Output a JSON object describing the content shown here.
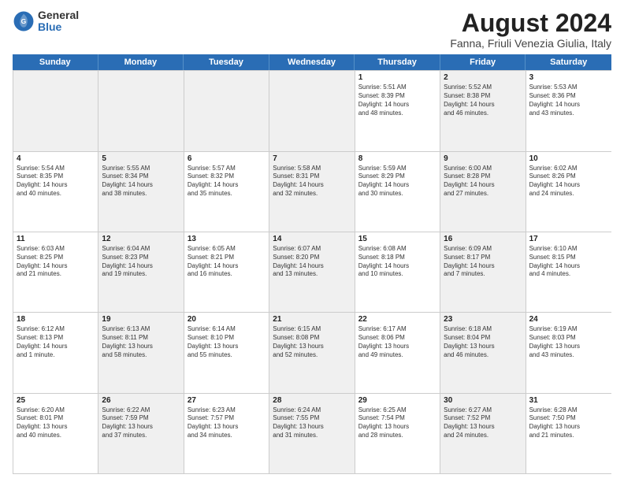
{
  "logo": {
    "general": "General",
    "blue": "Blue"
  },
  "title": "August 2024",
  "location": "Fanna, Friuli Venezia Giulia, Italy",
  "days": [
    "Sunday",
    "Monday",
    "Tuesday",
    "Wednesday",
    "Thursday",
    "Friday",
    "Saturday"
  ],
  "weeks": [
    [
      {
        "day": "",
        "text": "",
        "shaded": true
      },
      {
        "day": "",
        "text": "",
        "shaded": true
      },
      {
        "day": "",
        "text": "",
        "shaded": true
      },
      {
        "day": "",
        "text": "",
        "shaded": true
      },
      {
        "day": "1",
        "text": "Sunrise: 5:51 AM\nSunset: 8:39 PM\nDaylight: 14 hours\nand 48 minutes."
      },
      {
        "day": "2",
        "text": "Sunrise: 5:52 AM\nSunset: 8:38 PM\nDaylight: 14 hours\nand 46 minutes.",
        "shaded": true
      },
      {
        "day": "3",
        "text": "Sunrise: 5:53 AM\nSunset: 8:36 PM\nDaylight: 14 hours\nand 43 minutes."
      }
    ],
    [
      {
        "day": "4",
        "text": "Sunrise: 5:54 AM\nSunset: 8:35 PM\nDaylight: 14 hours\nand 40 minutes."
      },
      {
        "day": "5",
        "text": "Sunrise: 5:55 AM\nSunset: 8:34 PM\nDaylight: 14 hours\nand 38 minutes.",
        "shaded": true
      },
      {
        "day": "6",
        "text": "Sunrise: 5:57 AM\nSunset: 8:32 PM\nDaylight: 14 hours\nand 35 minutes."
      },
      {
        "day": "7",
        "text": "Sunrise: 5:58 AM\nSunset: 8:31 PM\nDaylight: 14 hours\nand 32 minutes.",
        "shaded": true
      },
      {
        "day": "8",
        "text": "Sunrise: 5:59 AM\nSunset: 8:29 PM\nDaylight: 14 hours\nand 30 minutes."
      },
      {
        "day": "9",
        "text": "Sunrise: 6:00 AM\nSunset: 8:28 PM\nDaylight: 14 hours\nand 27 minutes.",
        "shaded": true
      },
      {
        "day": "10",
        "text": "Sunrise: 6:02 AM\nSunset: 8:26 PM\nDaylight: 14 hours\nand 24 minutes."
      }
    ],
    [
      {
        "day": "11",
        "text": "Sunrise: 6:03 AM\nSunset: 8:25 PM\nDaylight: 14 hours\nand 21 minutes."
      },
      {
        "day": "12",
        "text": "Sunrise: 6:04 AM\nSunset: 8:23 PM\nDaylight: 14 hours\nand 19 minutes.",
        "shaded": true
      },
      {
        "day": "13",
        "text": "Sunrise: 6:05 AM\nSunset: 8:21 PM\nDaylight: 14 hours\nand 16 minutes."
      },
      {
        "day": "14",
        "text": "Sunrise: 6:07 AM\nSunset: 8:20 PM\nDaylight: 14 hours\nand 13 minutes.",
        "shaded": true
      },
      {
        "day": "15",
        "text": "Sunrise: 6:08 AM\nSunset: 8:18 PM\nDaylight: 14 hours\nand 10 minutes."
      },
      {
        "day": "16",
        "text": "Sunrise: 6:09 AM\nSunset: 8:17 PM\nDaylight: 14 hours\nand 7 minutes.",
        "shaded": true
      },
      {
        "day": "17",
        "text": "Sunrise: 6:10 AM\nSunset: 8:15 PM\nDaylight: 14 hours\nand 4 minutes."
      }
    ],
    [
      {
        "day": "18",
        "text": "Sunrise: 6:12 AM\nSunset: 8:13 PM\nDaylight: 14 hours\nand 1 minute."
      },
      {
        "day": "19",
        "text": "Sunrise: 6:13 AM\nSunset: 8:11 PM\nDaylight: 13 hours\nand 58 minutes.",
        "shaded": true
      },
      {
        "day": "20",
        "text": "Sunrise: 6:14 AM\nSunset: 8:10 PM\nDaylight: 13 hours\nand 55 minutes."
      },
      {
        "day": "21",
        "text": "Sunrise: 6:15 AM\nSunset: 8:08 PM\nDaylight: 13 hours\nand 52 minutes.",
        "shaded": true
      },
      {
        "day": "22",
        "text": "Sunrise: 6:17 AM\nSunset: 8:06 PM\nDaylight: 13 hours\nand 49 minutes."
      },
      {
        "day": "23",
        "text": "Sunrise: 6:18 AM\nSunset: 8:04 PM\nDaylight: 13 hours\nand 46 minutes.",
        "shaded": true
      },
      {
        "day": "24",
        "text": "Sunrise: 6:19 AM\nSunset: 8:03 PM\nDaylight: 13 hours\nand 43 minutes."
      }
    ],
    [
      {
        "day": "25",
        "text": "Sunrise: 6:20 AM\nSunset: 8:01 PM\nDaylight: 13 hours\nand 40 minutes."
      },
      {
        "day": "26",
        "text": "Sunrise: 6:22 AM\nSunset: 7:59 PM\nDaylight: 13 hours\nand 37 minutes.",
        "shaded": true
      },
      {
        "day": "27",
        "text": "Sunrise: 6:23 AM\nSunset: 7:57 PM\nDaylight: 13 hours\nand 34 minutes."
      },
      {
        "day": "28",
        "text": "Sunrise: 6:24 AM\nSunset: 7:55 PM\nDaylight: 13 hours\nand 31 minutes.",
        "shaded": true
      },
      {
        "day": "29",
        "text": "Sunrise: 6:25 AM\nSunset: 7:54 PM\nDaylight: 13 hours\nand 28 minutes."
      },
      {
        "day": "30",
        "text": "Sunrise: 6:27 AM\nSunset: 7:52 PM\nDaylight: 13 hours\nand 24 minutes.",
        "shaded": true
      },
      {
        "day": "31",
        "text": "Sunrise: 6:28 AM\nSunset: 7:50 PM\nDaylight: 13 hours\nand 21 minutes."
      }
    ]
  ]
}
